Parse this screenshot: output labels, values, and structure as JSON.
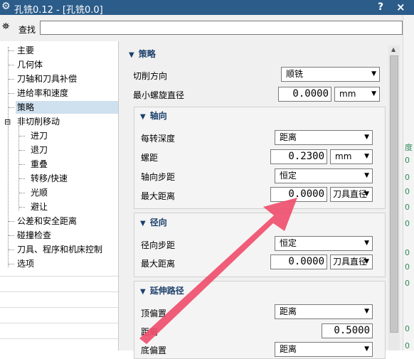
{
  "titlebar": {
    "title": "孔铣0.12 - [孔铣0.0]",
    "help": "?",
    "close": "×",
    "icon": "gear-icon"
  },
  "search": {
    "label": "查找",
    "value": "",
    "icon": "binoculars-icon"
  },
  "tree": {
    "items": [
      "主要",
      "几何体",
      "刀轴和刀具补偿",
      "进给率和速度",
      "策略",
      "非切削移动",
      "进刀",
      "退刀",
      "重叠",
      "转移/快速",
      "光顺",
      "避让",
      "公差和安全距离",
      "碰撞检查",
      "刀具、程序和机床控制",
      "选项"
    ],
    "selected": "策略",
    "expander": "⊟"
  },
  "strategy": {
    "title": "策略",
    "cut_direction_label": "切削方向",
    "cut_direction_value": "顺铣",
    "min_helix_label": "最小螺旋直径",
    "min_helix_value": "0.0000",
    "min_helix_unit": "mm"
  },
  "axial": {
    "title": "轴向",
    "depth_per_rev_label": "每转深度",
    "depth_per_rev_value": "距离",
    "pitch_label": "螺距",
    "pitch_value": "0.2300",
    "pitch_unit": "mm",
    "axial_step_label": "轴向步距",
    "axial_step_value": "恒定",
    "max_dist_label": "最大距离",
    "max_dist_value": "0.0000",
    "max_dist_unit": "刀具直径"
  },
  "radial": {
    "title": "径向",
    "radial_step_label": "径向步距",
    "radial_step_value": "恒定",
    "max_dist_label": "最大距离",
    "max_dist_value": "0.0000",
    "max_dist_unit": "刀具直径"
  },
  "extend": {
    "title": "延伸路径",
    "top_offset_label": "顶偏置",
    "top_offset_value": "距离",
    "distance_label": "距离",
    "distance_value": "0.5000",
    "bottom_offset_label": "底偏置",
    "bottom_offset_value": "距离"
  },
  "right_strip": {
    "chars": [
      "度",
      "0",
      "0",
      "0",
      "0",
      "0",
      "0",
      "0",
      "0",
      "0",
      "0"
    ]
  },
  "colors": {
    "titlebar": "#2b5c8a",
    "section_title": "#1b3f6b",
    "arrow": "#ef4f6c",
    "selection": "#cfe0ef"
  }
}
